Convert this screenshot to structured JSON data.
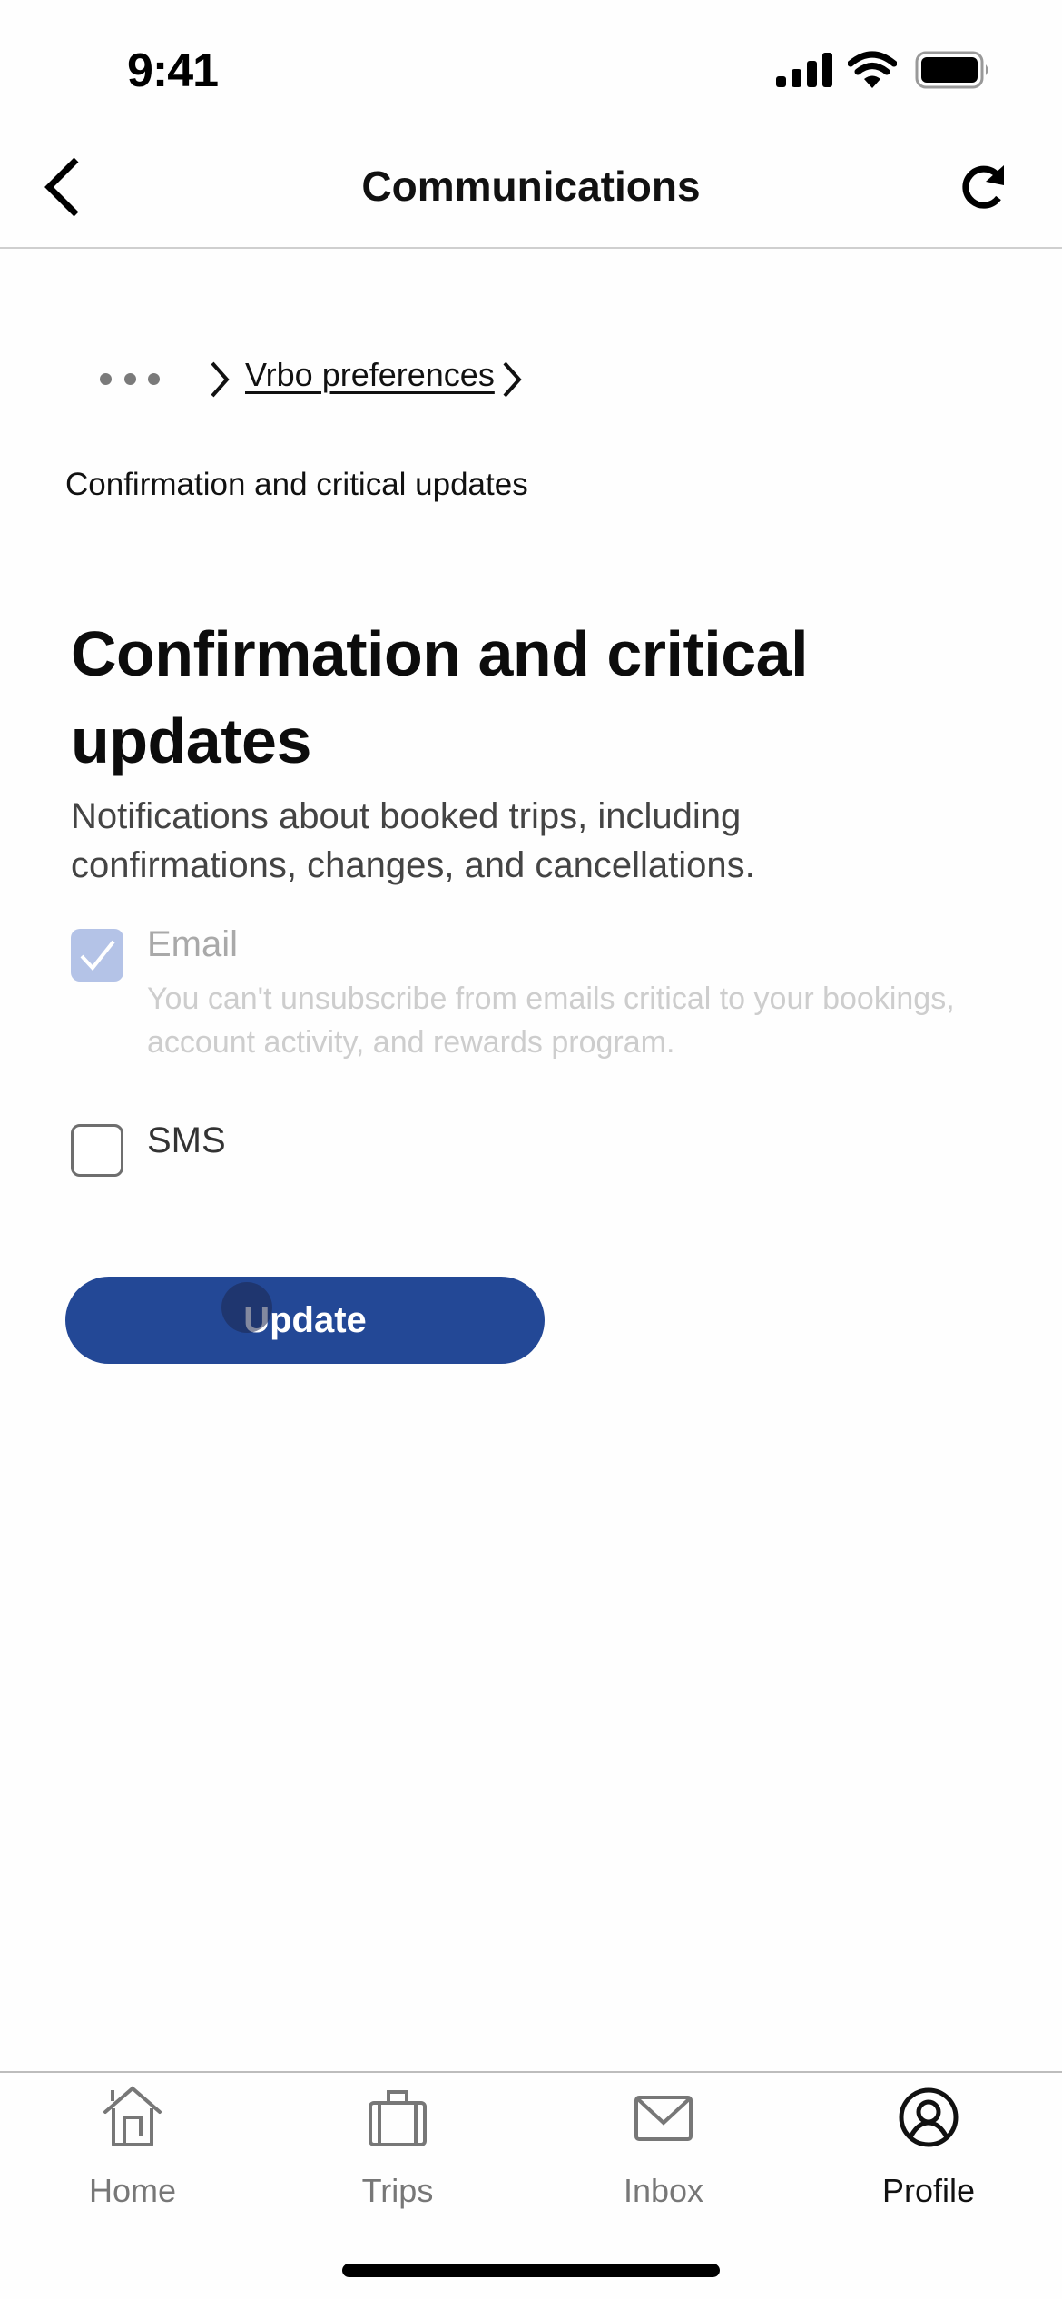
{
  "status_bar": {
    "time": "9:41",
    "icons": [
      "cellular-signal-icon",
      "wifi-icon",
      "battery-icon"
    ]
  },
  "nav": {
    "title": "Communications",
    "back_icon": "chevron-left-icon",
    "refresh_icon": "refresh-icon"
  },
  "breadcrumb": {
    "more_icon": "ellipsis-icon",
    "items": [
      {
        "label": "Vrbo preferences",
        "link": true
      }
    ],
    "current": "Confirmation and critical updates"
  },
  "section": {
    "title": "Confirmation and critical updates",
    "description": "Notifications about booked trips, including confirmations, changes, and cancellations."
  },
  "options": [
    {
      "label": "Email",
      "checked": true,
      "disabled": true,
      "helper": "You can't unsubscribe from emails critical to your bookings, account activity, and rewards program."
    },
    {
      "label": "SMS",
      "checked": false,
      "disabled": false
    }
  ],
  "update_button": {
    "label": "Update"
  },
  "tab_bar": {
    "items": [
      {
        "label": "Home",
        "icon": "home-icon",
        "active": false
      },
      {
        "label": "Trips",
        "icon": "suitcase-icon",
        "active": false
      },
      {
        "label": "Inbox",
        "icon": "envelope-icon",
        "active": false
      },
      {
        "label": "Profile",
        "icon": "profile-icon",
        "active": true
      }
    ]
  },
  "colors": {
    "primary": "#234896",
    "checkbox_disabled": "#b4c3e7",
    "text": "#111111",
    "muted": "#777777"
  }
}
